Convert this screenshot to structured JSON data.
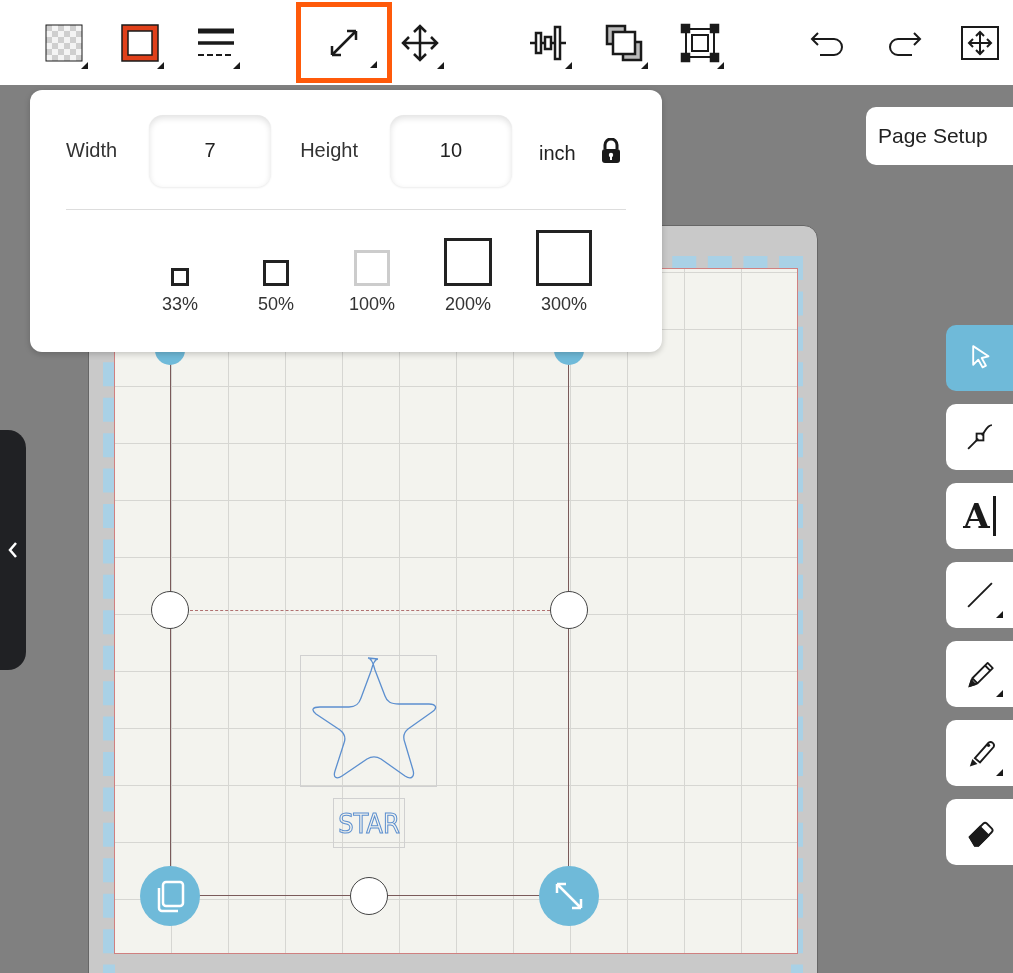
{
  "toolbar": {
    "groups": [
      [
        {
          "kind": "fill",
          "selected": false,
          "dropdown": true
        },
        {
          "kind": "stroke",
          "selected": false,
          "dropdown": true
        },
        {
          "kind": "line-style",
          "selected": false,
          "dropdown": true
        }
      ],
      [
        {
          "kind": "resize",
          "selected": true,
          "dropdown": true
        },
        {
          "kind": "move",
          "selected": false,
          "dropdown": true
        }
      ],
      [
        {
          "kind": "align",
          "selected": false,
          "dropdown": true
        },
        {
          "kind": "arrange",
          "selected": false,
          "dropdown": true
        },
        {
          "kind": "group",
          "selected": false,
          "dropdown": true
        }
      ],
      [
        {
          "kind": "undo",
          "selected": false,
          "dropdown": false
        },
        {
          "kind": "redo",
          "selected": false,
          "dropdown": false
        },
        {
          "kind": "fit",
          "selected": false,
          "dropdown": false
        }
      ]
    ]
  },
  "size_popup": {
    "width_label": "Width",
    "width_value": "7",
    "height_label": "Height",
    "height_value": "10",
    "unit": "inch",
    "locked": true,
    "presets": [
      {
        "label": "33%",
        "disabled": false
      },
      {
        "label": "50%",
        "disabled": false
      },
      {
        "label": "100%",
        "disabled": true
      },
      {
        "label": "200%",
        "disabled": false
      },
      {
        "label": "300%",
        "disabled": false
      }
    ]
  },
  "page_setup_button": "Page Setup",
  "side_tools": [
    {
      "kind": "select",
      "selected": true,
      "dropdown": false
    },
    {
      "kind": "node",
      "selected": false,
      "dropdown": false
    },
    {
      "kind": "text",
      "glyph": "A",
      "selected": false,
      "dropdown": false
    },
    {
      "kind": "line",
      "selected": false,
      "dropdown": true
    },
    {
      "kind": "pencil",
      "selected": false,
      "dropdown": true
    },
    {
      "kind": "marker",
      "selected": false,
      "dropdown": true
    },
    {
      "kind": "eraser",
      "selected": false,
      "dropdown": false
    }
  ],
  "canvas": {
    "design_text": "STAR"
  }
}
